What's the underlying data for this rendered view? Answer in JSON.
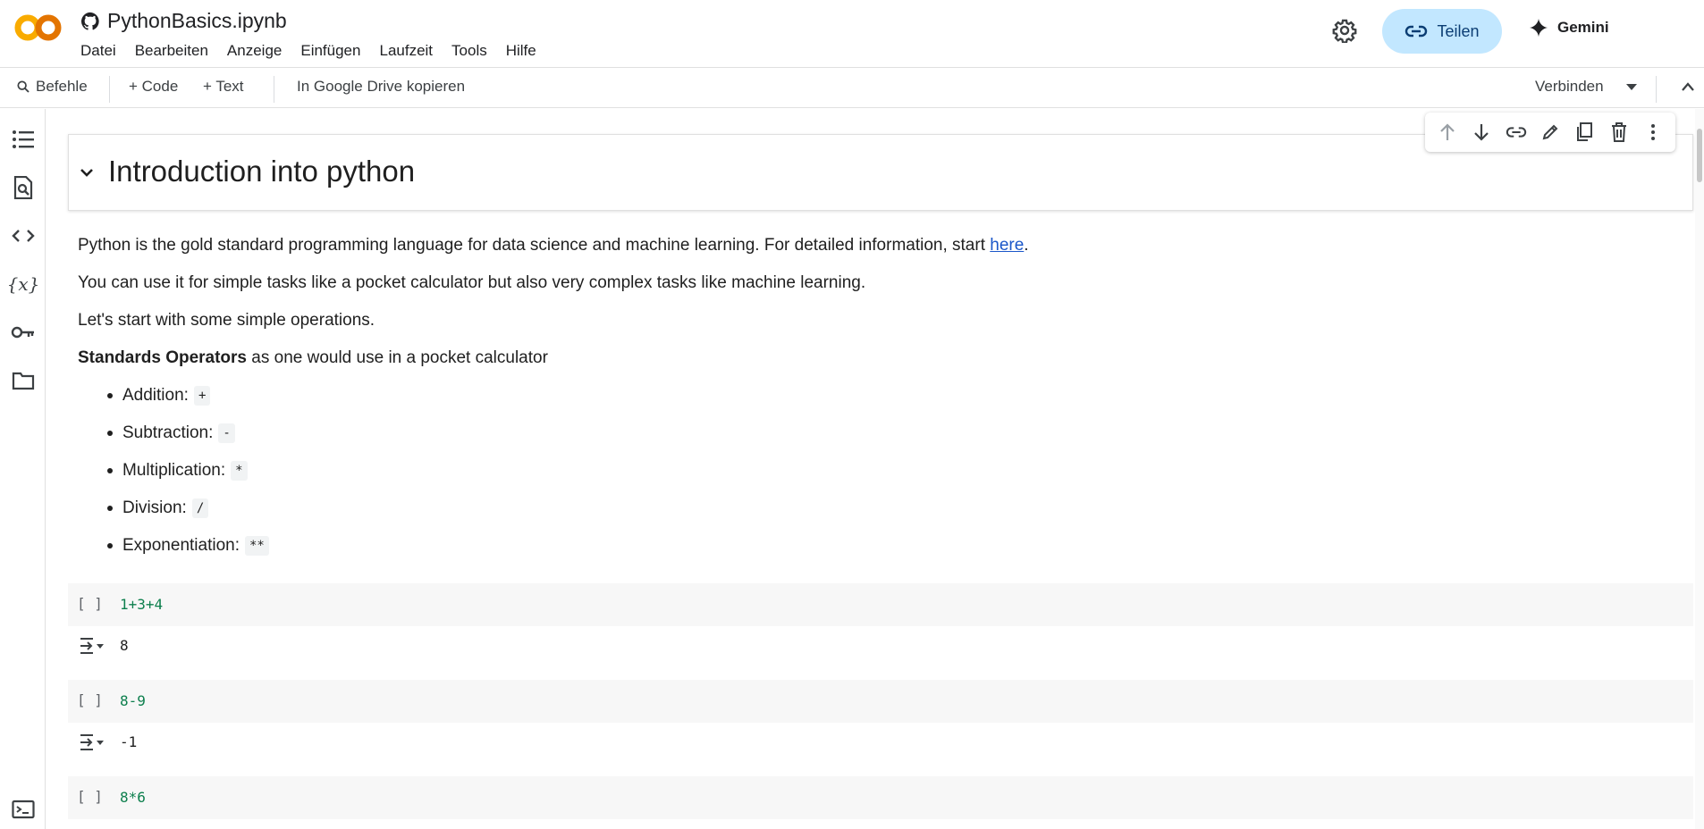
{
  "app": {
    "notebook_title": "PythonBasics.ipynb",
    "menu": [
      "Datei",
      "Bearbeiten",
      "Anzeige",
      "Einfügen",
      "Laufzeit",
      "Tools",
      "Hilfe"
    ],
    "share_label": "Teilen",
    "gemini_label": "Gemini",
    "colors": {
      "accent": "#c2e7ff",
      "logo_orange": "#f9ab00",
      "logo_dark": "#e37400",
      "link": "#1a56c9",
      "code_number": "#0d7f4d"
    }
  },
  "toolbar": {
    "commands_label": "Befehle",
    "add_code_label": "+ Code",
    "add_text_label": "+ Text",
    "copy_drive_label": "In Google Drive kopieren",
    "connect_label": "Verbinden"
  },
  "rail_icons": [
    "table-of-contents-icon",
    "find-icon",
    "code-snippets-icon",
    "variables-icon",
    "secrets-key-icon",
    "files-folder-icon",
    "terminal-icon"
  ],
  "notebook": {
    "heading": "Introduction into python",
    "intro_text": "Python is the gold standard programming language for data science and machine learning. For detailed information, start ",
    "intro_link": "here",
    "intro_end": ".",
    "line2": "You can use it for simple tasks like a pocket calculator but also very complex tasks like machine learning.",
    "line3": "Let's start with some simple operations.",
    "operators_bold": "Standards Operators",
    "operators_rest": " as one would use in a pocket calculator",
    "bullets": [
      {
        "label": "Addition:",
        "op": "+"
      },
      {
        "label": "Subtraction:",
        "op": "-"
      },
      {
        "label": "Multiplication:",
        "op": "*"
      },
      {
        "label": "Division:",
        "op": "/"
      },
      {
        "label": "Exponentiation:",
        "op": "**"
      }
    ],
    "cells": [
      {
        "prompt": "[ ]",
        "code": "1+3+4",
        "output": "8"
      },
      {
        "prompt": "[ ]",
        "code": "8-9",
        "output": "-1"
      },
      {
        "prompt": "[ ]",
        "code": "8*6"
      }
    ]
  }
}
